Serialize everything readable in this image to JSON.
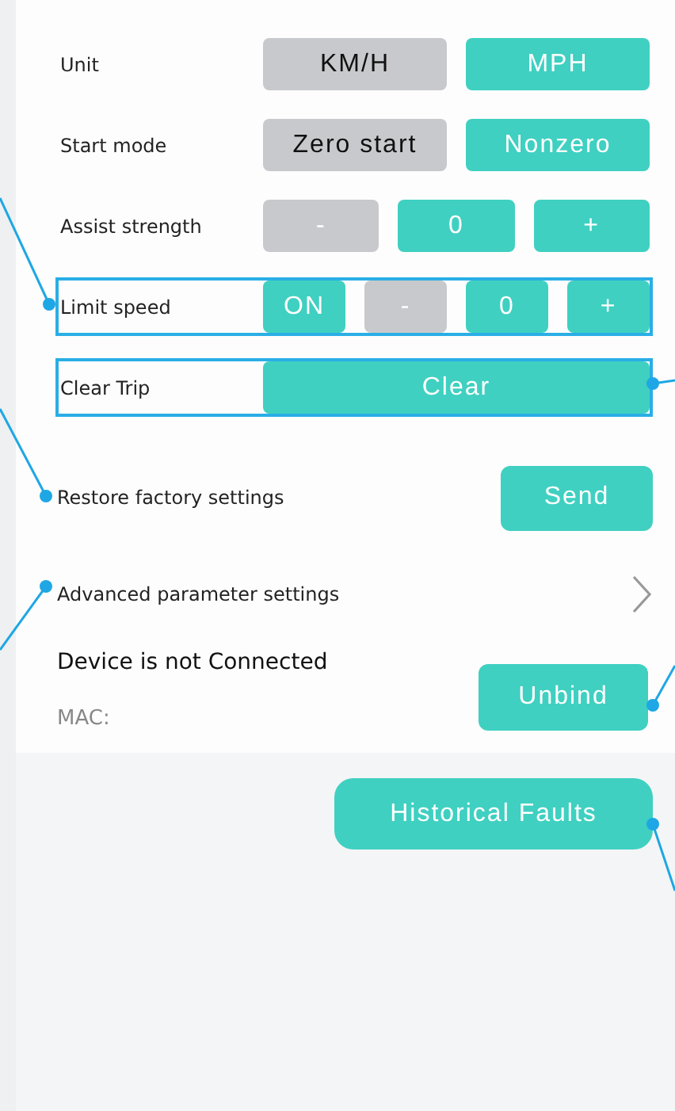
{
  "settings": [
    {
      "label": "Unit",
      "highlighted": false,
      "controls": [
        {
          "kind": "option",
          "label": "KM/H",
          "selected": false
        },
        {
          "kind": "option",
          "label": "MPH",
          "selected": true
        }
      ]
    },
    {
      "label": "Start mode",
      "highlighted": false,
      "controls": [
        {
          "kind": "option",
          "label": "Zero start",
          "selected": false
        },
        {
          "kind": "option",
          "label": "Nonzero",
          "selected": true
        }
      ]
    },
    {
      "label": "Assist strength",
      "highlighted": false,
      "controls": [
        {
          "kind": "step",
          "label": "-",
          "enabled": false
        },
        {
          "kind": "step",
          "label": "0",
          "enabled": true
        },
        {
          "kind": "step",
          "label": "+",
          "enabled": true
        }
      ]
    },
    {
      "label": "Limit speed",
      "highlighted": true,
      "controls": [
        {
          "kind": "option",
          "label": "ON",
          "selected": true
        },
        {
          "kind": "step",
          "label": "-",
          "enabled": false
        },
        {
          "kind": "step",
          "label": "0",
          "enabled": true
        },
        {
          "kind": "step",
          "label": "+",
          "enabled": true
        }
      ]
    },
    {
      "label": "Clear Trip",
      "highlighted": true,
      "controls": [
        {
          "kind": "step",
          "label": "Clear",
          "enabled": true
        }
      ]
    }
  ],
  "restore": {
    "label": "Restore factory settings",
    "button": "Send"
  },
  "advanced": {
    "label": "Advanced parameter settings"
  },
  "device": {
    "status": "Device is not Connected",
    "mac": "MAC:",
    "button": "Unbind"
  },
  "faults_button": "Historical Faults"
}
